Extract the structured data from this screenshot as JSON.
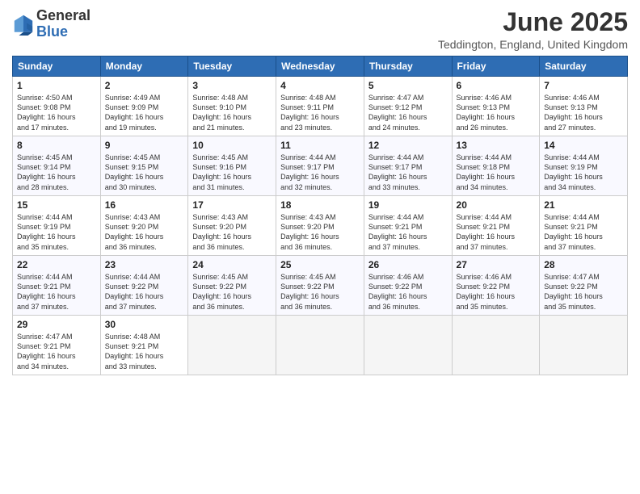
{
  "header": {
    "logo_general": "General",
    "logo_blue": "Blue",
    "title": "June 2025",
    "subtitle": "Teddington, England, United Kingdom"
  },
  "days_of_week": [
    "Sunday",
    "Monday",
    "Tuesday",
    "Wednesday",
    "Thursday",
    "Friday",
    "Saturday"
  ],
  "weeks": [
    [
      {
        "day": "1",
        "info": "Sunrise: 4:50 AM\nSunset: 9:08 PM\nDaylight: 16 hours\nand 17 minutes."
      },
      {
        "day": "2",
        "info": "Sunrise: 4:49 AM\nSunset: 9:09 PM\nDaylight: 16 hours\nand 19 minutes."
      },
      {
        "day": "3",
        "info": "Sunrise: 4:48 AM\nSunset: 9:10 PM\nDaylight: 16 hours\nand 21 minutes."
      },
      {
        "day": "4",
        "info": "Sunrise: 4:48 AM\nSunset: 9:11 PM\nDaylight: 16 hours\nand 23 minutes."
      },
      {
        "day": "5",
        "info": "Sunrise: 4:47 AM\nSunset: 9:12 PM\nDaylight: 16 hours\nand 24 minutes."
      },
      {
        "day": "6",
        "info": "Sunrise: 4:46 AM\nSunset: 9:13 PM\nDaylight: 16 hours\nand 26 minutes."
      },
      {
        "day": "7",
        "info": "Sunrise: 4:46 AM\nSunset: 9:13 PM\nDaylight: 16 hours\nand 27 minutes."
      }
    ],
    [
      {
        "day": "8",
        "info": "Sunrise: 4:45 AM\nSunset: 9:14 PM\nDaylight: 16 hours\nand 28 minutes."
      },
      {
        "day": "9",
        "info": "Sunrise: 4:45 AM\nSunset: 9:15 PM\nDaylight: 16 hours\nand 30 minutes."
      },
      {
        "day": "10",
        "info": "Sunrise: 4:45 AM\nSunset: 9:16 PM\nDaylight: 16 hours\nand 31 minutes."
      },
      {
        "day": "11",
        "info": "Sunrise: 4:44 AM\nSunset: 9:17 PM\nDaylight: 16 hours\nand 32 minutes."
      },
      {
        "day": "12",
        "info": "Sunrise: 4:44 AM\nSunset: 9:17 PM\nDaylight: 16 hours\nand 33 minutes."
      },
      {
        "day": "13",
        "info": "Sunrise: 4:44 AM\nSunset: 9:18 PM\nDaylight: 16 hours\nand 34 minutes."
      },
      {
        "day": "14",
        "info": "Sunrise: 4:44 AM\nSunset: 9:19 PM\nDaylight: 16 hours\nand 34 minutes."
      }
    ],
    [
      {
        "day": "15",
        "info": "Sunrise: 4:44 AM\nSunset: 9:19 PM\nDaylight: 16 hours\nand 35 minutes."
      },
      {
        "day": "16",
        "info": "Sunrise: 4:43 AM\nSunset: 9:20 PM\nDaylight: 16 hours\nand 36 minutes."
      },
      {
        "day": "17",
        "info": "Sunrise: 4:43 AM\nSunset: 9:20 PM\nDaylight: 16 hours\nand 36 minutes."
      },
      {
        "day": "18",
        "info": "Sunrise: 4:43 AM\nSunset: 9:20 PM\nDaylight: 16 hours\nand 36 minutes."
      },
      {
        "day": "19",
        "info": "Sunrise: 4:44 AM\nSunset: 9:21 PM\nDaylight: 16 hours\nand 37 minutes."
      },
      {
        "day": "20",
        "info": "Sunrise: 4:44 AM\nSunset: 9:21 PM\nDaylight: 16 hours\nand 37 minutes."
      },
      {
        "day": "21",
        "info": "Sunrise: 4:44 AM\nSunset: 9:21 PM\nDaylight: 16 hours\nand 37 minutes."
      }
    ],
    [
      {
        "day": "22",
        "info": "Sunrise: 4:44 AM\nSunset: 9:21 PM\nDaylight: 16 hours\nand 37 minutes."
      },
      {
        "day": "23",
        "info": "Sunrise: 4:44 AM\nSunset: 9:22 PM\nDaylight: 16 hours\nand 37 minutes."
      },
      {
        "day": "24",
        "info": "Sunrise: 4:45 AM\nSunset: 9:22 PM\nDaylight: 16 hours\nand 36 minutes."
      },
      {
        "day": "25",
        "info": "Sunrise: 4:45 AM\nSunset: 9:22 PM\nDaylight: 16 hours\nand 36 minutes."
      },
      {
        "day": "26",
        "info": "Sunrise: 4:46 AM\nSunset: 9:22 PM\nDaylight: 16 hours\nand 36 minutes."
      },
      {
        "day": "27",
        "info": "Sunrise: 4:46 AM\nSunset: 9:22 PM\nDaylight: 16 hours\nand 35 minutes."
      },
      {
        "day": "28",
        "info": "Sunrise: 4:47 AM\nSunset: 9:22 PM\nDaylight: 16 hours\nand 35 minutes."
      }
    ],
    [
      {
        "day": "29",
        "info": "Sunrise: 4:47 AM\nSunset: 9:21 PM\nDaylight: 16 hours\nand 34 minutes."
      },
      {
        "day": "30",
        "info": "Sunrise: 4:48 AM\nSunset: 9:21 PM\nDaylight: 16 hours\nand 33 minutes."
      },
      null,
      null,
      null,
      null,
      null
    ]
  ]
}
